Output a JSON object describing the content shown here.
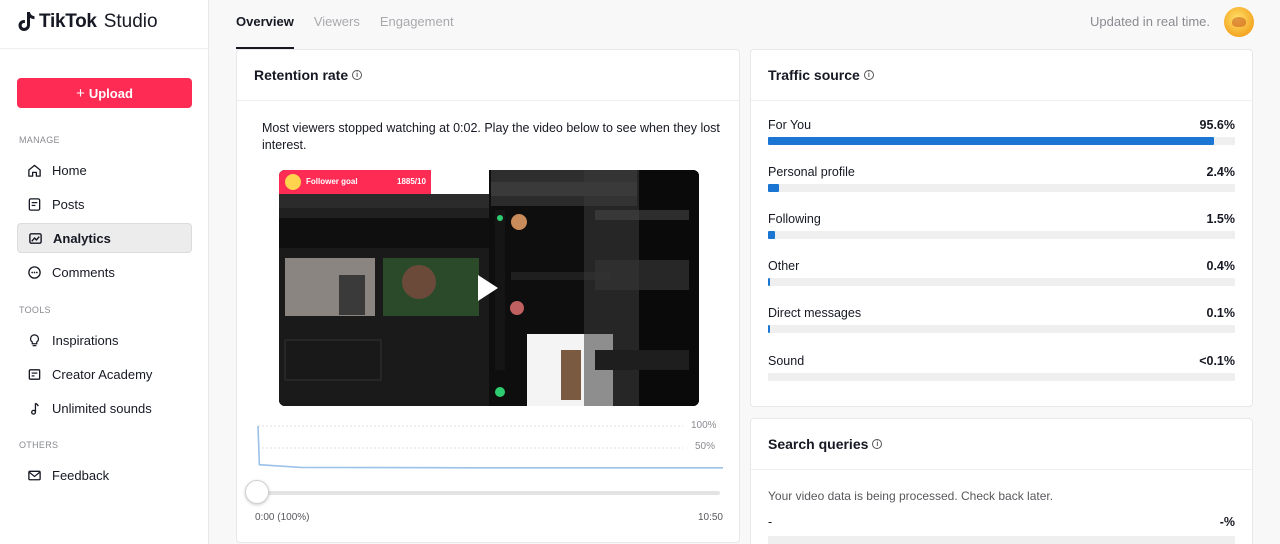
{
  "app": {
    "brand": "TikTok",
    "product": "Studio"
  },
  "sidebar": {
    "upload_label": "Upload",
    "sections": {
      "manage": "MANAGE",
      "tools": "TOOLS",
      "others": "OTHERS"
    },
    "items": [
      {
        "label": "Home",
        "icon": "home-icon"
      },
      {
        "label": "Posts",
        "icon": "posts-icon"
      },
      {
        "label": "Analytics",
        "icon": "analytics-icon",
        "active": true
      },
      {
        "label": "Comments",
        "icon": "comments-icon"
      },
      {
        "label": "Inspirations",
        "icon": "lightbulb-icon"
      },
      {
        "label": "Creator Academy",
        "icon": "academy-icon"
      },
      {
        "label": "Unlimited sounds",
        "icon": "music-note-icon"
      },
      {
        "label": "Feedback",
        "icon": "mail-icon"
      }
    ]
  },
  "header": {
    "tabs": [
      {
        "label": "Overview",
        "active": true
      },
      {
        "label": "Viewers"
      },
      {
        "label": "Engagement"
      }
    ],
    "status": "Updated in real time."
  },
  "retention": {
    "title": "Retention rate",
    "description": "Most viewers stopped watching at 0:02. Play the video below to see when they lost interest.",
    "time_start": "0:00 (100%)",
    "time_end": "10:50",
    "y_label_top": "100%",
    "y_label_mid": "50%",
    "video_overlay": {
      "goal_label": "Follower goal",
      "goal_value": "1885/10"
    },
    "chart_data": {
      "type": "line",
      "x": [
        0,
        2,
        60,
        180,
        300,
        420,
        540,
        650
      ],
      "y": [
        100,
        12,
        6,
        5.5,
        5,
        5,
        5,
        5
      ],
      "xlabel": "",
      "ylabel": "",
      "ylim": [
        0,
        100
      ],
      "grid": true
    }
  },
  "traffic": {
    "title": "Traffic source",
    "accent": "#1a76d2",
    "items": [
      {
        "label": "For You",
        "value": "95.6%",
        "pct": 95.6
      },
      {
        "label": "Personal profile",
        "value": "2.4%",
        "pct": 2.4
      },
      {
        "label": "Following",
        "value": "1.5%",
        "pct": 1.5
      },
      {
        "label": "Other",
        "value": "0.4%",
        "pct": 0.4
      },
      {
        "label": "Direct messages",
        "value": "0.1%",
        "pct": 0.1
      },
      {
        "label": "Sound",
        "value": "<0.1%",
        "pct": 0
      }
    ]
  },
  "search": {
    "title": "Search queries",
    "message": "Your video data is being processed. Check back later.",
    "row_label": "-",
    "row_value": "-%"
  }
}
